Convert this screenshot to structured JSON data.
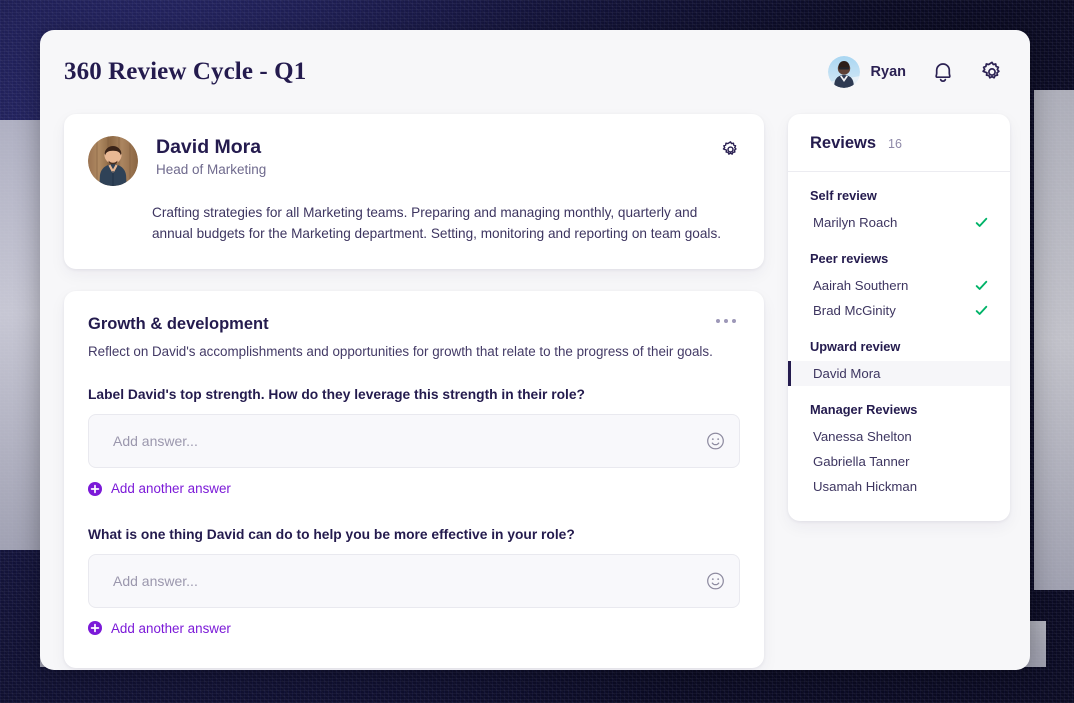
{
  "header": {
    "title": "360 Review Cycle - Q1",
    "user_name": "Ryan",
    "avatar_icon": "user-avatar-photo",
    "bell_icon": "bell-icon",
    "gear_icon": "gear-icon"
  },
  "profile": {
    "avatar_icon": "profile-avatar-photo",
    "name": "David Mora",
    "role": "Head of Marketing",
    "bio": "Crafting strategies for all Marketing teams. Preparing and managing monthly, quarterly and annual budgets for the Marketing department. Setting, monitoring and reporting on team goals.",
    "gear_icon": "gear-icon"
  },
  "growth": {
    "title": "Growth & development",
    "description": "Reflect on David's accomplishments and opportunities for growth that relate to the progress of their goals.",
    "menu_icon": "ellipsis-icon",
    "questions": [
      {
        "label": "Label David's top strength. How do they leverage this strength in their role?",
        "placeholder": "Add answer...",
        "value": "",
        "emoji_icon": "smiley-icon",
        "add_another_label": "Add another answer",
        "add_icon": "plus-circle-icon"
      },
      {
        "label": "What is one thing David can do to help you be more effective in your role?",
        "placeholder": "Add answer...",
        "value": "",
        "emoji_icon": "smiley-icon",
        "add_another_label": "Add another answer",
        "add_icon": "plus-circle-icon"
      }
    ]
  },
  "reviews": {
    "title": "Reviews",
    "count": "16",
    "groups": [
      {
        "title": "Self review",
        "items": [
          {
            "name": "Marilyn Roach",
            "completed": true,
            "active": false
          }
        ]
      },
      {
        "title": "Peer reviews",
        "items": [
          {
            "name": "Aairah Southern",
            "completed": true,
            "active": false
          },
          {
            "name": "Brad McGinity",
            "completed": true,
            "active": false
          }
        ]
      },
      {
        "title": "Upward review",
        "items": [
          {
            "name": "David Mora",
            "completed": false,
            "active": true
          }
        ]
      },
      {
        "title": "Manager Reviews",
        "items": [
          {
            "name": "Vanessa Shelton",
            "completed": false,
            "active": false
          },
          {
            "name": "Gabriella Tanner",
            "completed": false,
            "active": false
          },
          {
            "name": "Usamah Hickman",
            "completed": false,
            "active": false
          }
        ]
      }
    ]
  },
  "colors": {
    "accent_purple": "#7b19d8",
    "ink_navy": "#241b4e",
    "success_green": "#00b368",
    "page_bg": "#f7f7f9",
    "card_bg": "#ffffff",
    "field_bg": "#f8f8fb"
  }
}
